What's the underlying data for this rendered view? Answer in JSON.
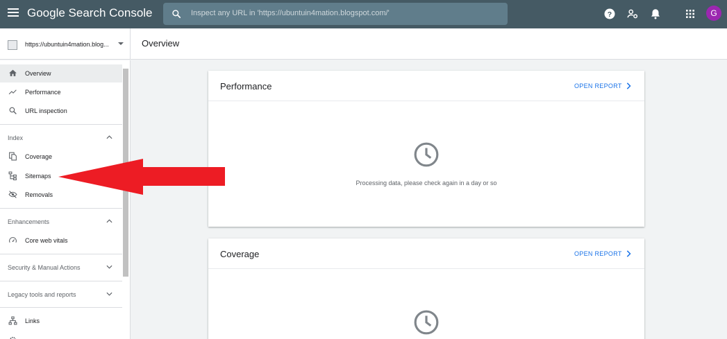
{
  "topbar": {
    "brand": "Google Search Console",
    "search_placeholder": "Inspect any URL in 'https://ubuntuin4mation.blogspot.com/'",
    "avatar_letter": "G",
    "avatar_color": "#9c27b0"
  },
  "property": {
    "url": "https://ubuntuin4mation.blog..."
  },
  "page": {
    "title": "Overview"
  },
  "sidebar": {
    "items": [
      {
        "label": "Overview",
        "icon": "home-icon",
        "active": true
      },
      {
        "label": "Performance",
        "icon": "trending-up-icon"
      },
      {
        "label": "URL inspection",
        "icon": "search-icon"
      }
    ],
    "index_section": "Index",
    "index_items": [
      {
        "label": "Coverage",
        "icon": "file-copy-icon"
      },
      {
        "label": "Sitemaps",
        "icon": "sitemap-icon"
      },
      {
        "label": "Removals",
        "icon": "visibility-off-icon"
      }
    ],
    "enhancements_section": "Enhancements",
    "enhancements_items": [
      {
        "label": "Core web vitals",
        "icon": "speed-icon"
      }
    ],
    "security_section": "Security & Manual Actions",
    "legacy_section": "Legacy tools and reports",
    "bottom_items": [
      {
        "label": "Links",
        "icon": "links-icon"
      }
    ]
  },
  "cards": [
    {
      "title": "Performance",
      "action": "OPEN REPORT",
      "message": "Processing data, please check again in a day or so"
    },
    {
      "title": "Coverage",
      "action": "OPEN REPORT",
      "message": ""
    }
  ],
  "colors": {
    "topbar": "#455a64",
    "accent": "#1a73e8",
    "arrow": "#ed1c24"
  }
}
